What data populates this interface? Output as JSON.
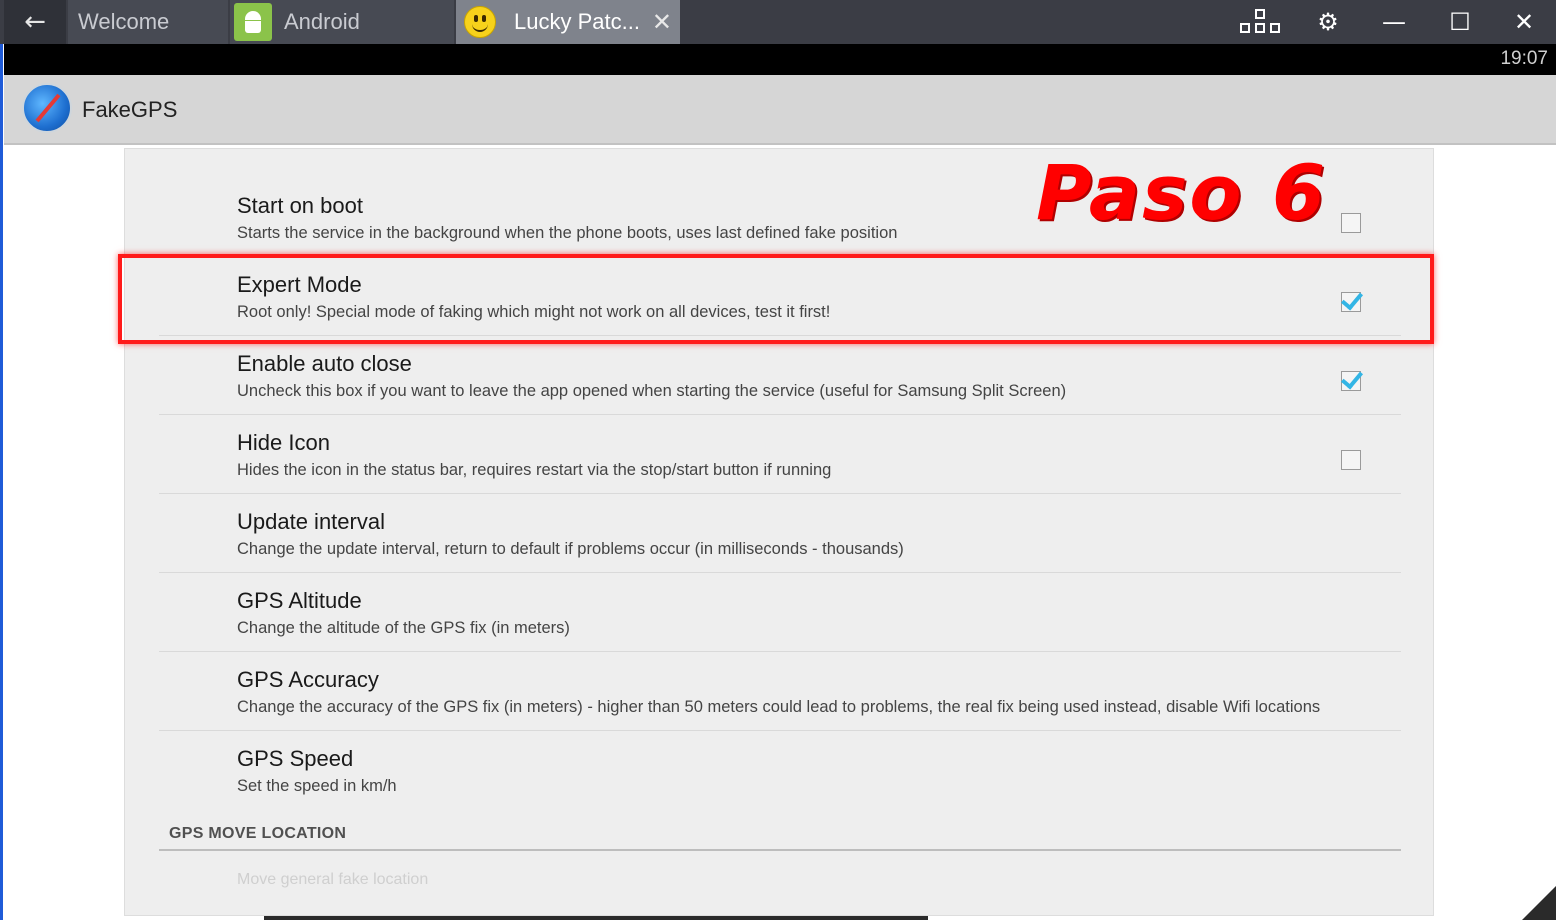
{
  "window": {
    "back_icon": "arrow-left-icon",
    "tabs": [
      {
        "label": "Welcome",
        "icon": ""
      },
      {
        "label": "Android",
        "icon": "android-icon"
      },
      {
        "label": "Lucky Patc...",
        "icon": "smiley-icon"
      }
    ],
    "tab_close_glyph": "✕",
    "controls": {
      "keymap_icon": "keymap-icon",
      "settings_glyph": "⚙",
      "minimize_glyph": "—",
      "maximize_glyph": "☐",
      "close_glyph": "✕"
    }
  },
  "statusbar": {
    "clock": "19:07"
  },
  "app": {
    "title": "FakeGPS",
    "icon": "compass-icon"
  },
  "preferences": [
    {
      "title": "Start on boot",
      "summary": "Starts the service in the background when the phone boots, uses last defined fake position",
      "has_checkbox": true,
      "checked": false
    },
    {
      "title": "Expert Mode",
      "summary": "Root only! Special mode of faking which might not work on all devices, test it first!",
      "has_checkbox": true,
      "checked": true
    },
    {
      "title": "Enable auto close",
      "summary": "Uncheck this box if you want to leave the app opened when starting the service (useful for Samsung Split Screen)",
      "has_checkbox": true,
      "checked": true
    },
    {
      "title": "Hide Icon",
      "summary": "Hides the icon in the status bar, requires restart via the stop/start button if running",
      "has_checkbox": true,
      "checked": false
    },
    {
      "title": "Update interval",
      "summary": "Change the update interval, return to default if problems occur (in milliseconds - thousands)",
      "has_checkbox": false
    },
    {
      "title": "GPS Altitude",
      "summary": "Change the altitude of the GPS fix (in meters)",
      "has_checkbox": false
    },
    {
      "title": "GPS Accuracy",
      "summary": "Change the accuracy of the GPS fix (in meters) - higher than 50 meters could lead to problems, the real fix being used instead, disable Wifi locations",
      "has_checkbox": false
    },
    {
      "title": "GPS Speed",
      "summary": "Set the speed in km/h",
      "has_checkbox": false
    }
  ],
  "section": {
    "label": "GPS MOVE LOCATION"
  },
  "faded_item": "Move general fake location",
  "annotation": {
    "step_label": "Paso 6",
    "color": "#ff0000"
  },
  "colors": {
    "titlebar": "#3b3d45",
    "active_tab": "#7f838c",
    "checkbox_accent": "#33b5e5",
    "card_bg": "#eeeeee"
  }
}
